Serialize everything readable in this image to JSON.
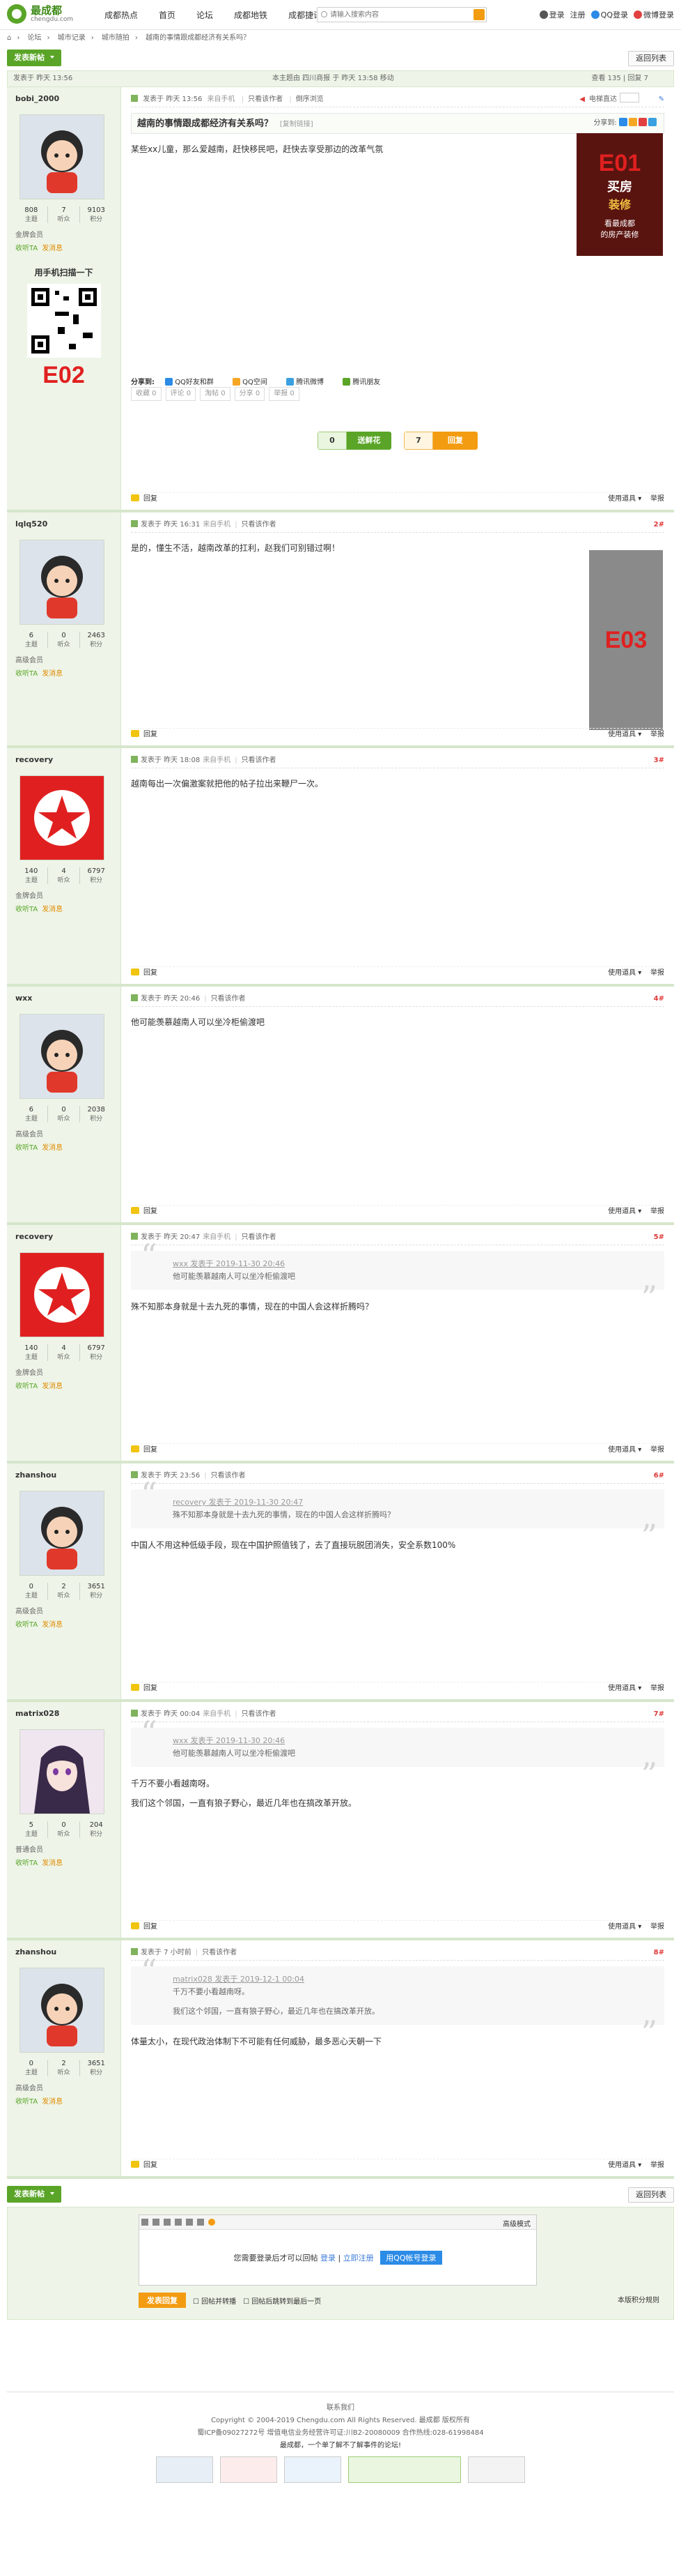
{
  "header": {
    "logo_title": "最成都",
    "logo_sub": "chengdu.com",
    "nav": [
      "成都热点",
      "首页",
      "论坛",
      "成都地铁",
      "成都捷讯"
    ],
    "search_placeholder": "请输入搜索内容",
    "login": "登录",
    "register": "注册",
    "qq_login": "QQ登录",
    "weibo_login": "微博登录"
  },
  "breadcrumb": [
    "论坛",
    "城市记录",
    "城市随拍",
    "越南的事情跟成都经济有关系吗？"
  ],
  "toolbar": {
    "new_post": "发表新帖",
    "back_list": "返回列表"
  },
  "thread_info": {
    "left_label": "发表于 昨天",
    "left_time": "13:56",
    "center": "本主题由 四川商报 于 昨天 13:58 移动",
    "right": "查看 135 | 回复 7"
  },
  "posts": [
    {
      "user": "bobi_2000",
      "avatar": "girl-icon",
      "stats": {
        "topics": "808",
        "listen": "7",
        "score": "9103"
      },
      "stat_labels": [
        "主题",
        "听众",
        "积分"
      ],
      "level": "金牌会员",
      "meta": "发表于 昨天 13:56",
      "device": "来自手机",
      "only_author": "只看该作者",
      "reverse": "倒序浏览",
      "floor_label": "电梯直达",
      "title": "越南的事情跟成都经济有关系吗？",
      "copy": "[复制链接]",
      "content": "某些xx儿童，那么爱越南，赶快移民吧，赶快去享受那边的改革气氛",
      "share_label": "分享到:",
      "shares": [
        "QQ好友和群",
        "QQ空间",
        "腾讯微博",
        "腾讯朋友"
      ],
      "ops": [
        "收藏 0",
        "评论 0",
        "淘帖 0",
        "分享 0",
        "举报 0"
      ],
      "vote_up": {
        "count": "0",
        "label": "送鲜花"
      },
      "vote_down": {
        "count": "7",
        "label": "回复"
      }
    },
    {
      "user": "lqlq520",
      "stats": {
        "topics": "6",
        "listen": "0",
        "score": "2463"
      },
      "level": "高级会员",
      "meta": "发表于 昨天 16:31",
      "device": "来自手机",
      "only_author": "只看该作者",
      "floor": "2#",
      "content": "是的，懂生不活，越南改革的扛利，赵我们可别错过啊！"
    },
    {
      "user": "recovery",
      "stats": {
        "topics": "140",
        "listen": "4",
        "score": "6797"
      },
      "level": "金牌会员",
      "meta": "发表于 昨天 18:08",
      "device": "来自手机",
      "only_author": "只看该作者",
      "floor": "3#",
      "content": "越南每出一次偏激案就把他的帖子拉出来鞭尸一次。"
    },
    {
      "user": "wxx",
      "stats": {
        "topics": "6",
        "listen": "0",
        "score": "2038"
      },
      "level": "高级会员",
      "meta": "发表于 昨天 20:46",
      "only_author": "只看该作者",
      "floor": "4#",
      "content": "他可能羡慕越南人可以坐冷柜偷渡吧"
    },
    {
      "user": "recovery",
      "stats": {
        "topics": "140",
        "listen": "4",
        "score": "6797"
      },
      "level": "金牌会员",
      "meta": "发表于 昨天 20:47",
      "device": "来自手机",
      "only_author": "只看该作者",
      "floor": "5#",
      "quote_meta": "wxx 发表于 2019-11-30 20:46",
      "quote_text": "他可能羡慕越南人可以坐冷柜偷渡吧",
      "content": "殊不知那本身就是十去九死的事情，现在的中国人会这样折腾吗？"
    },
    {
      "user": "zhanshou",
      "stats": {
        "topics": "0",
        "listen": "2",
        "score": "3651"
      },
      "level": "高级会员",
      "meta": "发表于 昨天 23:56",
      "only_author": "只看该作者",
      "floor": "6#",
      "quote_meta": "recovery 发表于 2019-11-30 20:47",
      "quote_text": "殊不知那本身就是十去九死的事情，现在的中国人会这样折腾吗？",
      "content": "中国人不用这种低级手段，现在中国护照值钱了，去了直接玩脱团消失，安全系数100%"
    },
    {
      "user": "matrix028",
      "stats": {
        "topics": "5",
        "listen": "0",
        "score": "204"
      },
      "level": "普通会员",
      "meta": "发表于 昨天 00:04",
      "device": "来自手机",
      "only_author": "只看该作者",
      "floor": "7#",
      "quote_meta": "wxx 发表于 2019-11-30 20:46",
      "quote_text": "他可能羡慕越南人可以坐冷柜偷渡吧",
      "content_lines": [
        "千万不要小看越南呀。",
        "我们这个邻国，一直有狼子野心，最近几年也在搞改革开放。"
      ]
    },
    {
      "user": "zhanshou",
      "stats": {
        "topics": "0",
        "listen": "2",
        "score": "3651"
      },
      "level": "高级会员",
      "meta": "发表于 7 小时前",
      "only_author": "只看该作者",
      "floor": "8#",
      "quote_meta": "matrix028 发表于 2019-12-1 00:04",
      "quote_lines": [
        "千万不要小看越南呀。",
        "我们这个邻国，一直有狼子野心，最近几年也在搞改革开放。"
      ],
      "content": "体量太小，在现代政治体制下不可能有任何威胁，最多恶心天朝一下"
    }
  ],
  "sidebar_common": {
    "send_msg": "发消息",
    "listen": "收听TA",
    "qr_title": "用手机扫描一下"
  },
  "post_footer": {
    "manage": "回复",
    "tools": "使用道具",
    "report": "举报"
  },
  "reply": {
    "login_hint": "您需要登录后才可以回帖",
    "login": "登录",
    "sep": "|",
    "register": "立即注册",
    "qq_btn": "用QQ帐号登录",
    "advanced": "高级模式",
    "submit": "发表回复",
    "check1": "回帖并转播",
    "check2": "回帖后跳转到最后一页",
    "rules": "本版积分规则"
  },
  "footer": {
    "links": "联系我们",
    "copyright": "Copyright © 2004-2019 Chengdu.com All Rights Reserved. 最成都  版权所有",
    "icp": "蜀ICP备09027272号   增值电信业务经营许可证:川B2-20080009   合作热线:028-61998484",
    "report_text": "最成都，一个单了解不了解事件的论坛!"
  },
  "ads": {
    "e01": "E01",
    "e02": "E02",
    "e03": "E03"
  },
  "ad_text": {
    "e01_line1": "买房",
    "e01_line2": "装修",
    "e01_line3": "看最成都",
    "e01_line4": "的房产装修"
  },
  "colors": {
    "brand": "#5aa528",
    "accent": "#f39c12",
    "side_bg": "#eef5e8",
    "ad_red": "#e02020"
  }
}
